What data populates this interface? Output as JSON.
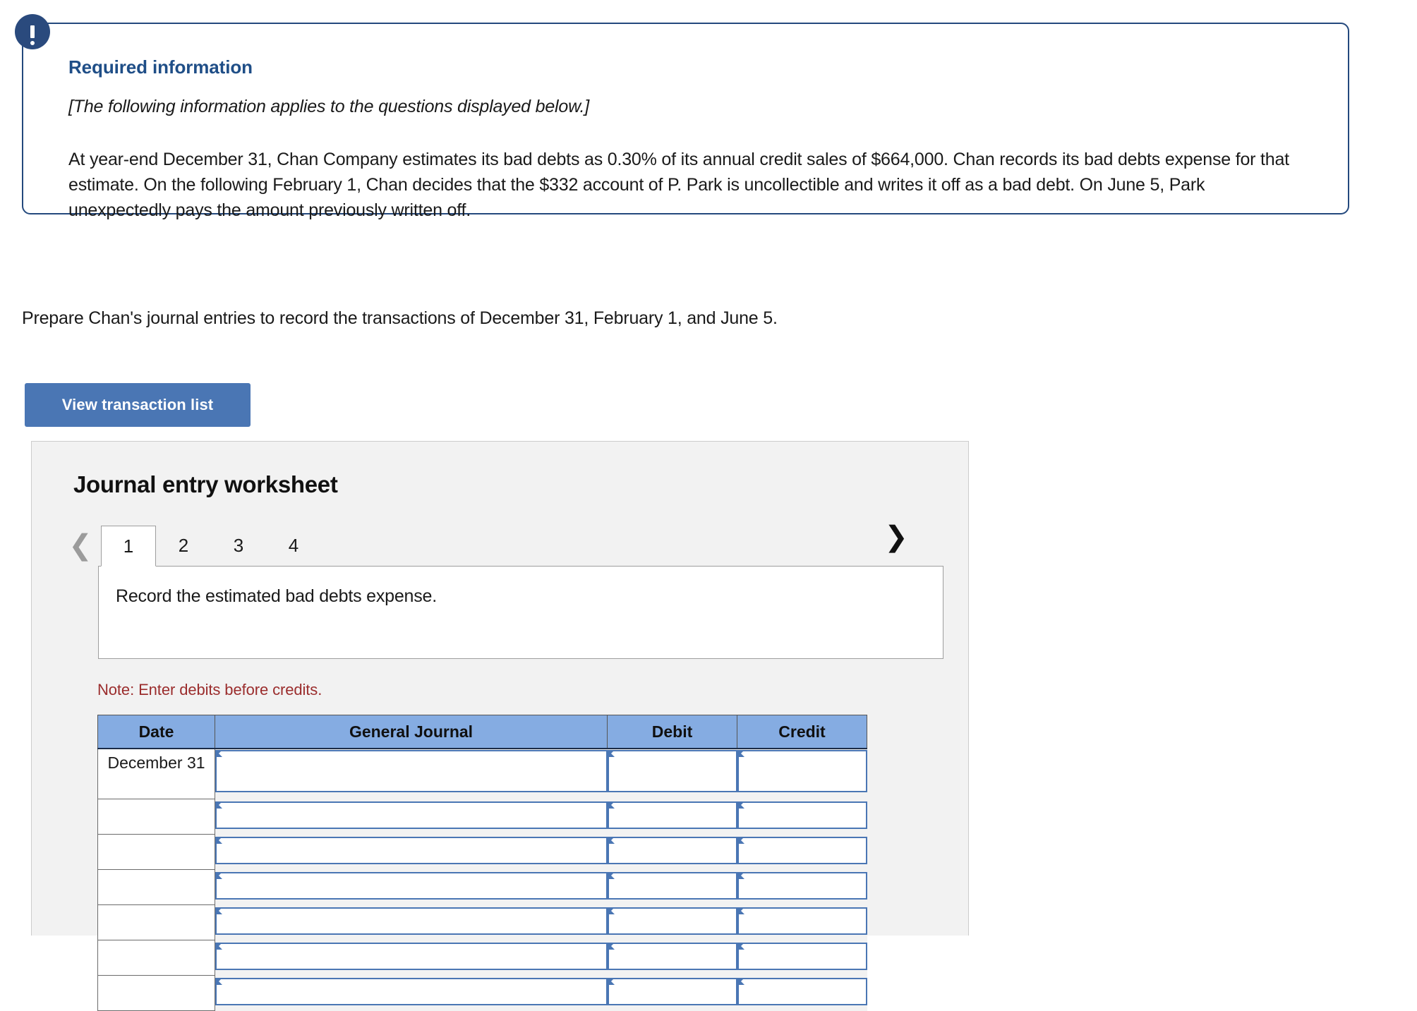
{
  "alert": {
    "icon": "exclamation-icon",
    "title": "Required information",
    "subtitle": "[The following information applies to the questions displayed below.]",
    "body": "At year-end December 31, Chan Company estimates its bad debts as 0.30% of its annual credit sales of $664,000. Chan records its bad debts expense for that estimate. On the following February 1, Chan decides that the $332 account of P. Park is uncollectible and writes it off as a bad debt. On June 5, Park unexpectedly pays the amount previously written off.",
    "border_color": "#24497d",
    "icon_color": "#2a4a7d"
  },
  "prompt": "Prepare Chan's journal entries to record the transactions of December 31, February 1, and June 5.",
  "view_button": {
    "label": "View transaction list",
    "color": "#4a76b4"
  },
  "worksheet": {
    "title": "Journal entry worksheet",
    "prev_icon": "chevron-left-icon",
    "next_icon": "chevron-right-icon",
    "tabs": [
      {
        "label": "1",
        "active": true
      },
      {
        "label": "2",
        "active": false
      },
      {
        "label": "3",
        "active": false
      },
      {
        "label": "4",
        "active": false
      }
    ],
    "entry_description": "Record the estimated bad debts expense.",
    "note": "Note: Enter debits before credits.",
    "note_color": "#9b2d2d",
    "table": {
      "header_color": "#85ace2",
      "columns": [
        "Date",
        "General Journal",
        "Debit",
        "Credit"
      ],
      "rows": [
        {
          "date": "December 31",
          "general_journal": "",
          "debit": "",
          "credit": ""
        },
        {
          "date": "",
          "general_journal": "",
          "debit": "",
          "credit": ""
        },
        {
          "date": "",
          "general_journal": "",
          "debit": "",
          "credit": ""
        },
        {
          "date": "",
          "general_journal": "",
          "debit": "",
          "credit": ""
        },
        {
          "date": "",
          "general_journal": "",
          "debit": "",
          "credit": ""
        },
        {
          "date": "",
          "general_journal": "",
          "debit": "",
          "credit": ""
        },
        {
          "date": "",
          "general_journal": "",
          "debit": "",
          "credit": ""
        }
      ]
    }
  }
}
